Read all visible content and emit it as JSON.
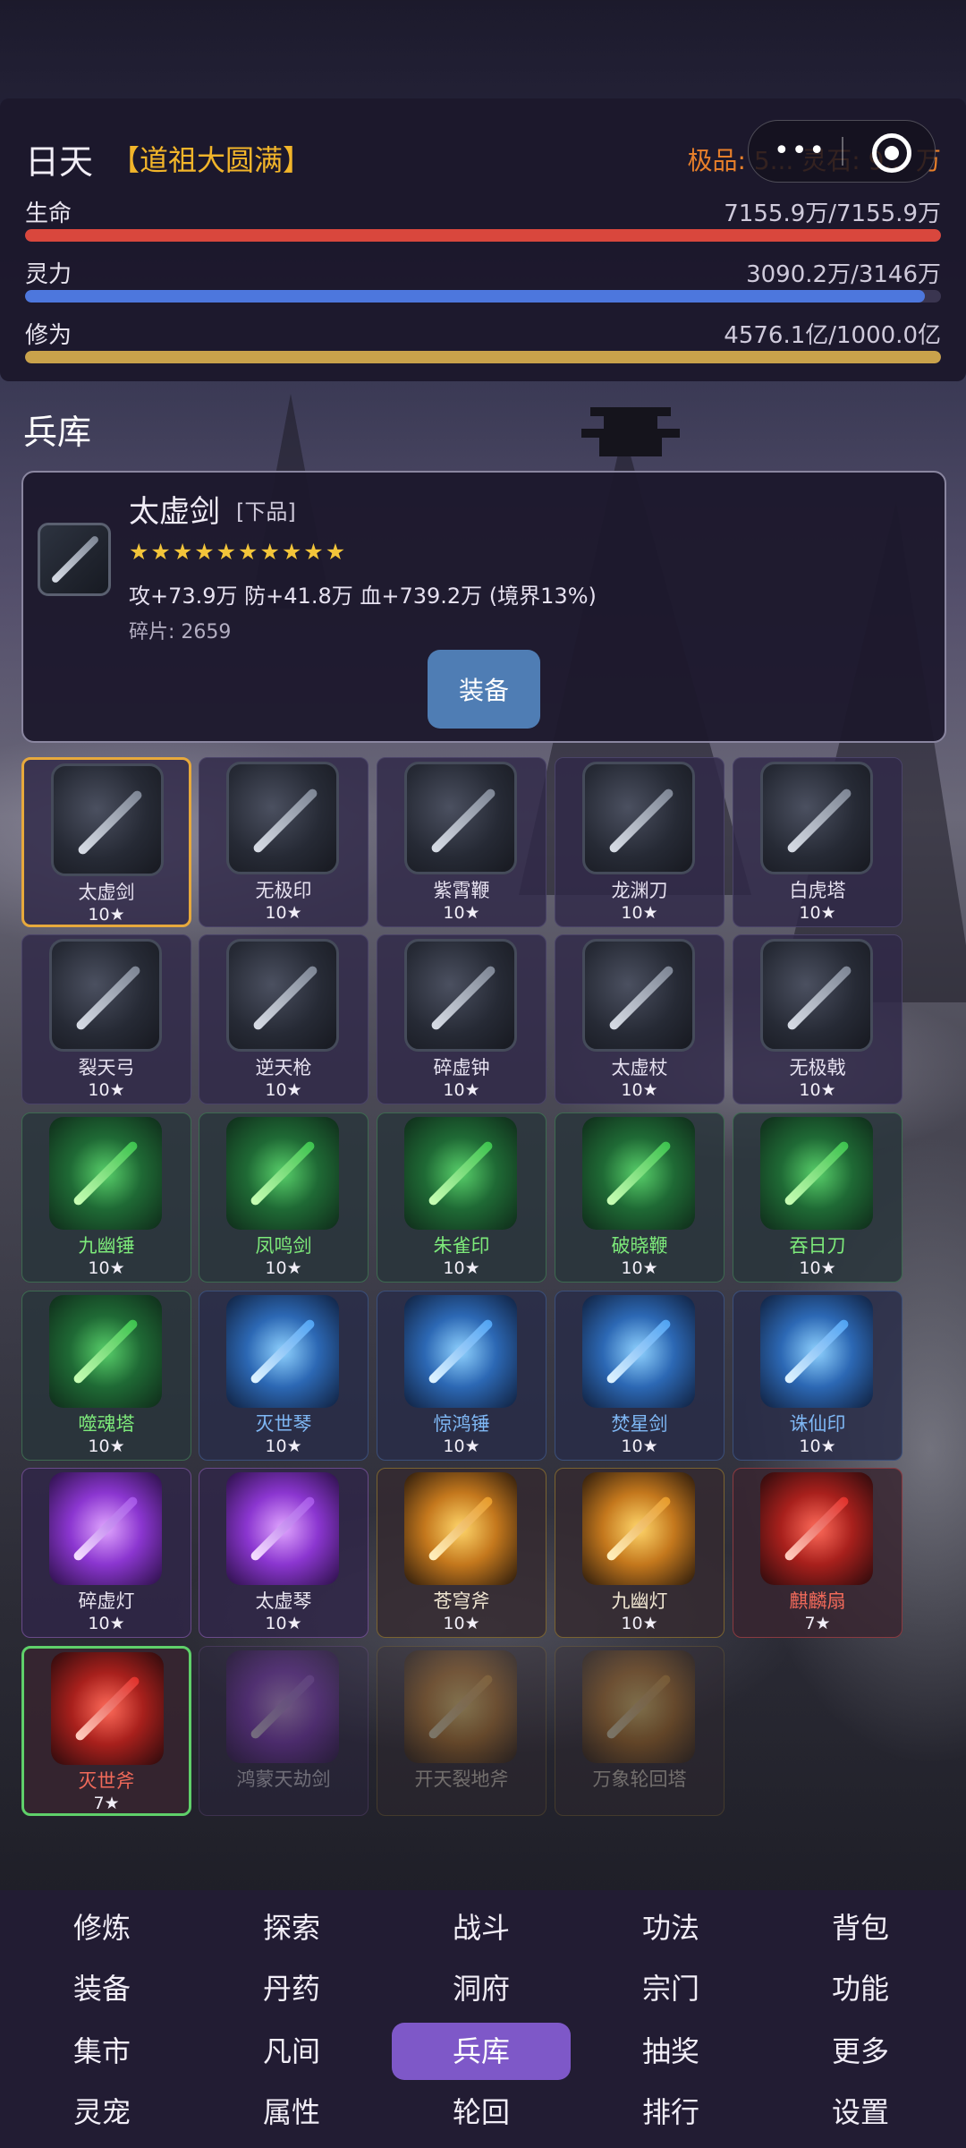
{
  "player": {
    "name": "日天",
    "realm": "【道祖大圆满】",
    "currency": "极品: 5... 灵石: 9... 万"
  },
  "stats": [
    {
      "label": "生命",
      "value": "7155.9万/7155.9万",
      "fraction": 1.0,
      "color": "#d9473d"
    },
    {
      "label": "灵力",
      "value": "3090.2万/3146万",
      "fraction": 0.982,
      "color": "#4d77dd"
    },
    {
      "label": "修为",
      "value": "4576.1亿/1000.0亿",
      "fraction": 1.0,
      "color": "#c9a24b"
    }
  ],
  "section_title": "兵库",
  "detail": {
    "name": "太虚剑",
    "grade": "[下品]",
    "stars": "★★★★★★★★★★",
    "stats": "攻+73.9万  防+41.8万  血+739.2万 (境界13%)",
    "fragments": "碎片: 2659",
    "equip_label": "装备"
  },
  "weapons": [
    {
      "name": "太虚剑",
      "level": "10★",
      "quality": "gray",
      "selected": true
    },
    {
      "name": "无极印",
      "level": "10★",
      "quality": "gray"
    },
    {
      "name": "紫霄鞭",
      "level": "10★",
      "quality": "gray"
    },
    {
      "name": "龙渊刀",
      "level": "10★",
      "quality": "gray"
    },
    {
      "name": "白虎塔",
      "level": "10★",
      "quality": "gray"
    },
    {
      "name": "裂天弓",
      "level": "10★",
      "quality": "gray"
    },
    {
      "name": "逆天枪",
      "level": "10★",
      "quality": "gray"
    },
    {
      "name": "碎虚钟",
      "level": "10★",
      "quality": "gray"
    },
    {
      "name": "太虚杖",
      "level": "10★",
      "quality": "gray"
    },
    {
      "name": "无极戟",
      "level": "10★",
      "quality": "gray"
    },
    {
      "name": "九幽锤",
      "level": "10★",
      "quality": "green"
    },
    {
      "name": "凤鸣剑",
      "level": "10★",
      "quality": "green"
    },
    {
      "name": "朱雀印",
      "level": "10★",
      "quality": "green"
    },
    {
      "name": "破晓鞭",
      "level": "10★",
      "quality": "green"
    },
    {
      "name": "吞日刀",
      "level": "10★",
      "quality": "green"
    },
    {
      "name": "噬魂塔",
      "level": "10★",
      "quality": "green"
    },
    {
      "name": "灭世琴",
      "level": "10★",
      "quality": "blue"
    },
    {
      "name": "惊鸿锤",
      "level": "10★",
      "quality": "blue"
    },
    {
      "name": "焚星剑",
      "level": "10★",
      "quality": "blue"
    },
    {
      "name": "诛仙印",
      "level": "10★",
      "quality": "blue"
    },
    {
      "name": "碎虚灯",
      "level": "10★",
      "quality": "purple"
    },
    {
      "name": "太虚琴",
      "level": "10★",
      "quality": "purple"
    },
    {
      "name": "苍穹斧",
      "level": "10★",
      "quality": "gold"
    },
    {
      "name": "九幽灯",
      "level": "10★",
      "quality": "gold"
    },
    {
      "name": "麒麟扇",
      "level": "7★",
      "quality": "red"
    },
    {
      "name": "灭世斧",
      "level": "7★",
      "quality": "red",
      "selected": true
    },
    {
      "name": "鸿蒙天劫剑",
      "level": "",
      "quality": "purple",
      "locked": true
    },
    {
      "name": "开天裂地斧",
      "level": "",
      "quality": "gold",
      "locked": true
    },
    {
      "name": "万象轮回塔",
      "level": "",
      "quality": "gold",
      "locked": true
    }
  ],
  "nav": [
    [
      "修炼",
      "探索",
      "战斗",
      "功法",
      "背包"
    ],
    [
      "装备",
      "丹药",
      "洞府",
      "宗门",
      "功能"
    ],
    [
      "集市",
      "凡间",
      "兵库",
      "抽奖",
      "更多"
    ],
    [
      "灵宠",
      "属性",
      "轮回",
      "排行",
      "设置"
    ]
  ],
  "nav_active": "兵库"
}
